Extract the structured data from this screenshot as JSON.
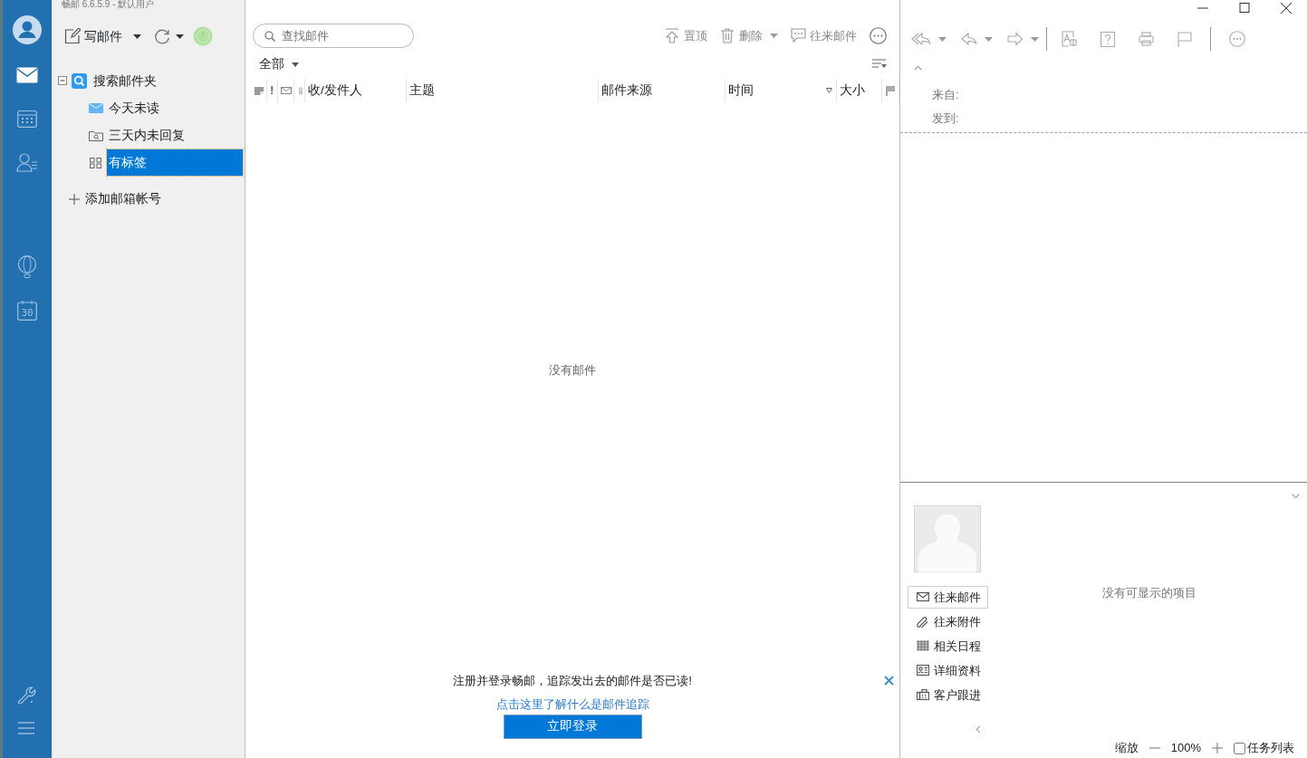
{
  "app_title": "畅邮 6.6.5.9  -  默认用户",
  "rail": {
    "items": [
      {
        "kind": "mail",
        "selected": true
      },
      {
        "kind": "calendar",
        "selected": false
      },
      {
        "kind": "contacts",
        "selected": false
      },
      {
        "kind": "balloon",
        "selected": false
      },
      {
        "kind": "day",
        "label": "30",
        "selected": false
      }
    ],
    "bottom": [
      {
        "kind": "wrench"
      },
      {
        "kind": "menu"
      }
    ]
  },
  "toolbar": {
    "compose": "写邮件"
  },
  "folders": {
    "label": "搜索邮件夹",
    "expanded": true,
    "children": [
      {
        "label": "今天未读",
        "kind": "mail",
        "selected": false
      },
      {
        "label": "三天内未回复",
        "kind": "folder",
        "selected": false
      },
      {
        "label": "有标签",
        "kind": "tags",
        "selected": true
      }
    ]
  },
  "add_account": "添加邮箱帐号",
  "search": {
    "placeholder": "查找邮件"
  },
  "list_actions": [
    {
      "label": "置顶",
      "kind": "pin",
      "dropdown": false
    },
    {
      "label": "删除",
      "kind": "trash",
      "dropdown": true
    },
    {
      "label": "往来邮件",
      "kind": "chat",
      "dropdown": false
    }
  ],
  "filter": "全部",
  "columns": [
    {
      "kind": "note"
    },
    {
      "kind": "text",
      "label": "!"
    },
    {
      "kind": "mail"
    },
    {
      "kind": "clip"
    },
    {
      "kind": "text",
      "label": "收/发件人",
      "sorted": false
    },
    {
      "kind": "text",
      "label": "主题",
      "sorted": false
    },
    {
      "kind": "text",
      "label": "邮件来源",
      "sorted": false
    },
    {
      "kind": "text",
      "label": "时间",
      "sorted": true
    },
    {
      "kind": "text",
      "label": "大小",
      "sorted": false
    },
    {
      "kind": "flag"
    }
  ],
  "empty_list": "没有邮件",
  "banner": {
    "message": "注册并登录畅邮，追踪发出去的邮件是否已读!",
    "link": "点击这里了解什么是邮件追踪",
    "button": "立即登录"
  },
  "reader": {
    "fields": [
      "来自:",
      "发到:"
    ]
  },
  "contact_tabs": [
    {
      "label": "往来邮件",
      "kind": "mail",
      "selected": true
    },
    {
      "label": "往来附件",
      "kind": "clip",
      "selected": false
    },
    {
      "label": "相关日程",
      "kind": "calendar",
      "selected": false
    },
    {
      "label": "详细资料",
      "kind": "card",
      "selected": false
    },
    {
      "label": "客户跟进",
      "kind": "fax",
      "selected": false
    }
  ],
  "contact_empty": "没有可显示的项目",
  "status": {
    "zoom_label": "缩放",
    "zoom": "100%",
    "task_list": {
      "label": "任务列表",
      "checked": false
    }
  }
}
